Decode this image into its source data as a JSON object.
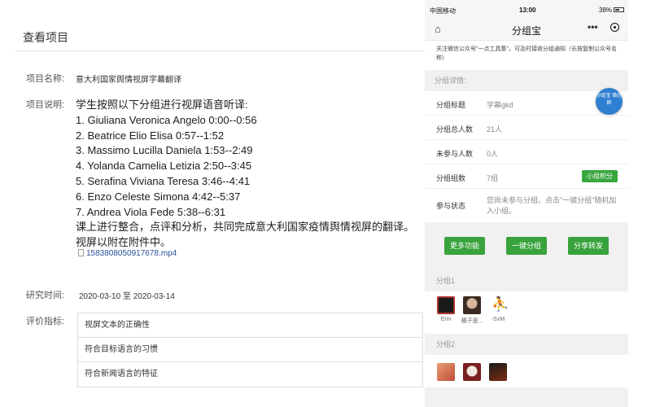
{
  "left": {
    "page_title": "查看项目",
    "project_name_label": "项目名称:",
    "project_name_value": "意大利国家舆情视屏字幕翻译",
    "description_label": "项目说明:",
    "description_lines": [
      "学生按照以下分组进行视屏语音听译:",
      "1. Giuliana Veronica Angelo 0:00--0:56",
      "2. Beatrice Elio Elisa 0:57--1:52",
      "3. Massimo Lucilla Daniela 1:53--2:49",
      "4. Yolanda Camelia Letizia 2:50--3:45",
      "5. Serafina Viviana Teresa 3:46--4:41",
      "6. Enzo Celeste Simona 4:42--5:37",
      "7. Andrea Viola Fede 5:38--6:31",
      "课上进行整合，点评和分析，共同完成意大利国家疫情舆情视屏的翻译。",
      "视屏以附在附件中。"
    ],
    "attachment": "1583808050917678.mp4",
    "research_time_label": "研究时间:",
    "research_time_value": "2020-03-10 至 2020-03-14",
    "criteria_label": "评价指标:",
    "criteria": [
      "视屏文本的正确性",
      "符合目标语言的习惯",
      "符合新闻语言的特征"
    ]
  },
  "phone": {
    "status_bar": {
      "carrier": "中国移动",
      "time": "13:00",
      "battery": "38%"
    },
    "nav": {
      "title": "分组宝",
      "more_glyph": "•••"
    },
    "notice": "关注微信公众号\"一点工具集\"，可及时接收分组通知（长按复制公众号名称）",
    "details_header": "分组详情:",
    "float_button": "分组宝 微信群",
    "details": {
      "title_label": "分组标题",
      "title_value": "字幕gkd",
      "total_label": "分组总人数",
      "total_value": "21人",
      "absent_label": "未参与人数",
      "absent_value": "0人",
      "groups_label": "分组组数",
      "groups_value": "7组",
      "score_button": "小组积分",
      "status_label": "参与状态",
      "status_value": "您尚未参与分组。点击\"一键分组\"随机加入小组。"
    },
    "buttons": {
      "more": "更多功能",
      "one_click": "一键分组",
      "share": "分享转发"
    },
    "group1": {
      "label": "分组1",
      "members": [
        "Erin",
        "橘子是...",
        "-SxM"
      ]
    },
    "group2": {
      "label": "分组2"
    },
    "colors": {
      "accent_green": "#38a33c",
      "float_blue": "#2f7fd0"
    }
  }
}
